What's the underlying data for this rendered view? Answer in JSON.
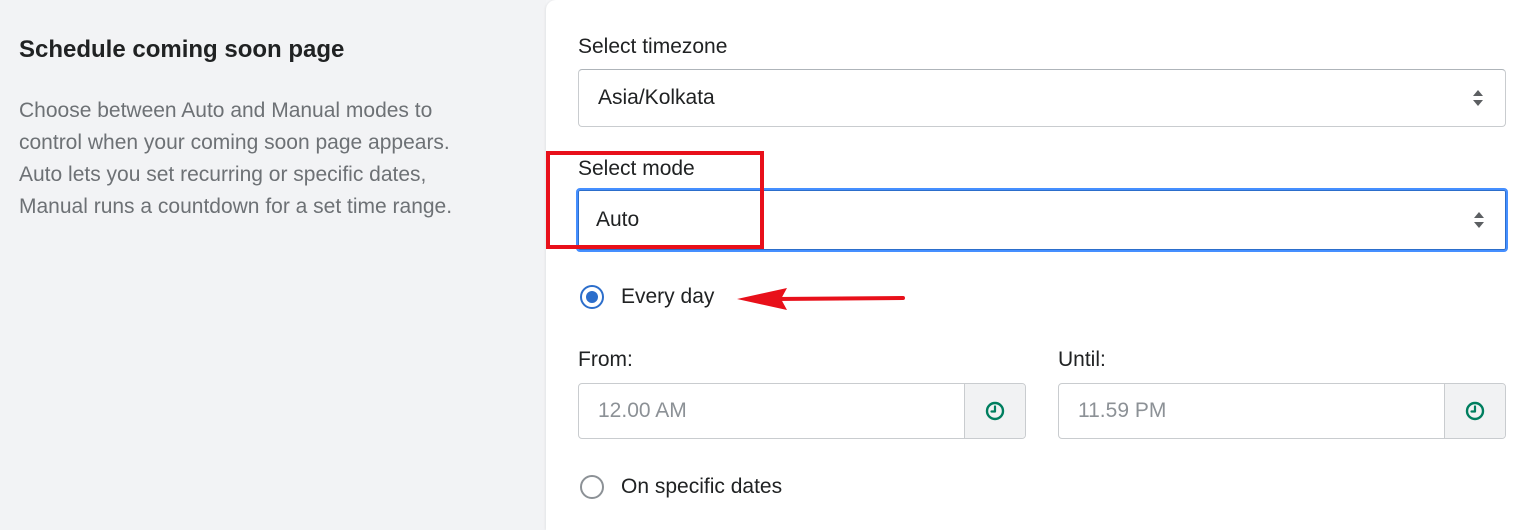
{
  "section": {
    "title": "Schedule coming soon page",
    "description": "Choose between Auto and Manual modes to control when your coming soon page appears. Auto lets you set recurring or specific dates, Manual runs a countdown for a set time range."
  },
  "timezone": {
    "label": "Select timezone",
    "value": "Asia/Kolkata"
  },
  "mode": {
    "label": "Select mode",
    "value": "Auto"
  },
  "options": {
    "every_day": "Every day",
    "specific_dates": "On specific dates",
    "selected": "every_day"
  },
  "time_range": {
    "from_label": "From:",
    "from_value": "12.00 AM",
    "until_label": "Until:",
    "until_value": "11.59 PM"
  },
  "icons": {
    "select_caret": "up-down-caret-icon",
    "time": "clock-icon"
  },
  "colors": {
    "accent": "#2c6ecb",
    "focus_border": "#458fff",
    "annotation": "#e8101a",
    "clock_icon": "#007f5f"
  }
}
